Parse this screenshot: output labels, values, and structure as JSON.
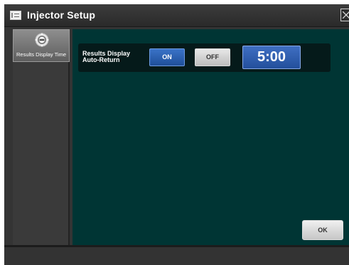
{
  "window": {
    "title": "Injector Setup",
    "icon": "list-icon",
    "close_icon": "close-icon"
  },
  "sidebar": {
    "items": [
      {
        "label": "Results Display Time",
        "icon": "settings-badge-icon",
        "selected": true
      }
    ]
  },
  "main": {
    "setting": {
      "label_line1": "Results Display",
      "label_line2": "Auto-Return",
      "on_label": "ON",
      "off_label": "OFF",
      "selected": "ON",
      "time_value": "5:00"
    },
    "ok_label": "OK"
  },
  "colors": {
    "panel_bg": "#003534",
    "row_bg": "#051a1a",
    "on_blue": "#2a5fb0",
    "time_blue": "#2f5dae",
    "sidebar_bg": "#3a3a3a",
    "title_bg": "#333333"
  }
}
